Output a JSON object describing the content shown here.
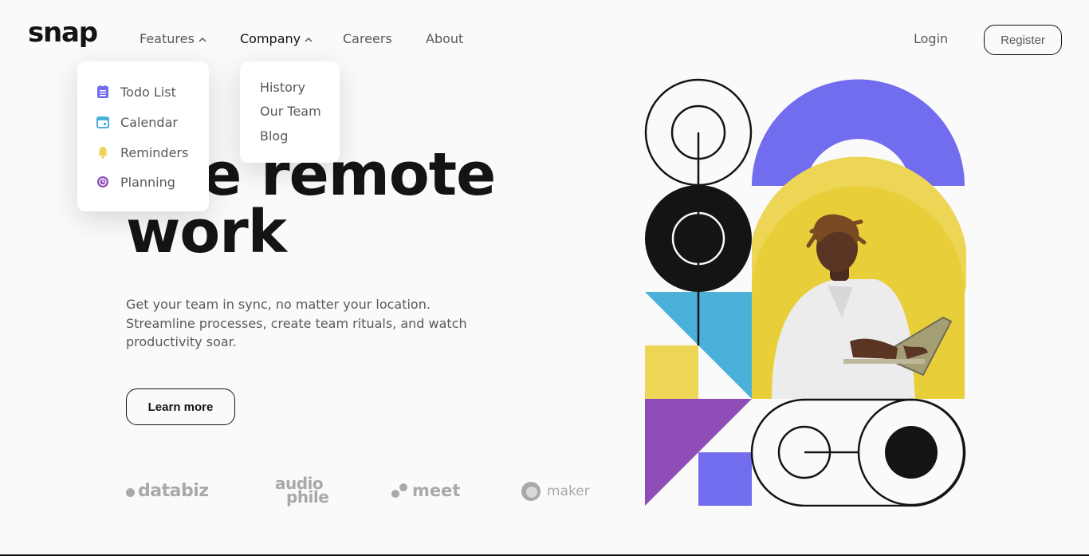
{
  "app": {
    "logo": "snap"
  },
  "nav": {
    "features": "Features",
    "company": "Company",
    "careers": "Careers",
    "about": "About",
    "login": "Login",
    "register": "Register"
  },
  "features_menu": [
    {
      "label": "Todo List",
      "icon": "todo-list-icon",
      "color": "#726CEE"
    },
    {
      "label": "Calendar",
      "icon": "calendar-icon",
      "color": "#4BB1DA"
    },
    {
      "label": "Reminders",
      "icon": "bell-icon",
      "color": "#EDD556"
    },
    {
      "label": "Planning",
      "icon": "planning-icon",
      "color": "#8E4CB6"
    }
  ],
  "company_menu": [
    {
      "label": "History"
    },
    {
      "label": "Our Team"
    },
    {
      "label": "Blog"
    }
  ],
  "hero": {
    "title_line1": "ake remote",
    "title_line2": "work",
    "description": "Get your team in sync, no matter your location. Streamline processes, create team rituals, and watch productivity soar.",
    "cta": "Learn more"
  },
  "clients": {
    "databiz": "databiz",
    "audio_top": "audio",
    "audio_bottom": "phile",
    "meet": "meet",
    "maker": "maker"
  },
  "colors": {
    "ink": "#141414",
    "gray": "#595959",
    "purple": "#726CEE",
    "blue": "#4BB1DA",
    "yellow": "#EDD556",
    "violet": "#8E4CB6"
  }
}
